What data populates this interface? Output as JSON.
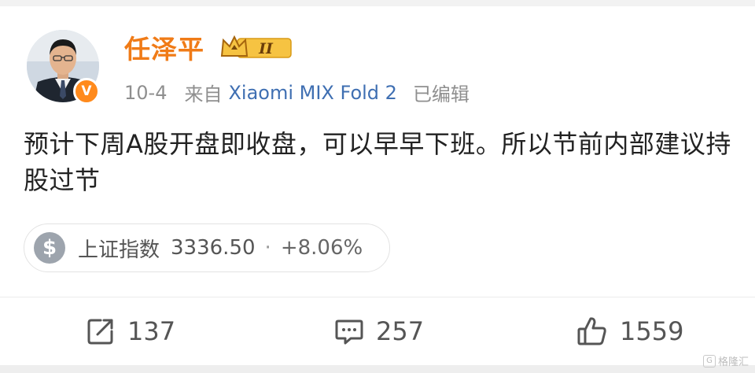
{
  "post": {
    "username": "任泽平",
    "level_badge": "II",
    "date": "10-4",
    "source_prefix": "来自",
    "device": "Xiaomi MIX Fold 2",
    "edited": "已编辑",
    "verify_mark": "V",
    "text": "预计下周A股开盘即收盘，可以早早下班。所以节前内部建议持股过节"
  },
  "stock_card": {
    "icon_symbol": "$",
    "name": "上证指数",
    "value": "3336.50",
    "separator": "·",
    "change": "+8.06%"
  },
  "actions": {
    "repost_count": "137",
    "comment_count": "257",
    "like_count": "1559"
  },
  "watermark": {
    "text": "格隆汇",
    "mark": "G"
  },
  "colors": {
    "username": "#f07b17",
    "device_link": "#3f6fb2",
    "verify_badge": "#ff8a1c",
    "stock_icon": "#9da4ad"
  },
  "icons": [
    "repost-icon",
    "comment-icon",
    "like-icon",
    "crown-icon",
    "verified-icon",
    "dollar-icon"
  ]
}
